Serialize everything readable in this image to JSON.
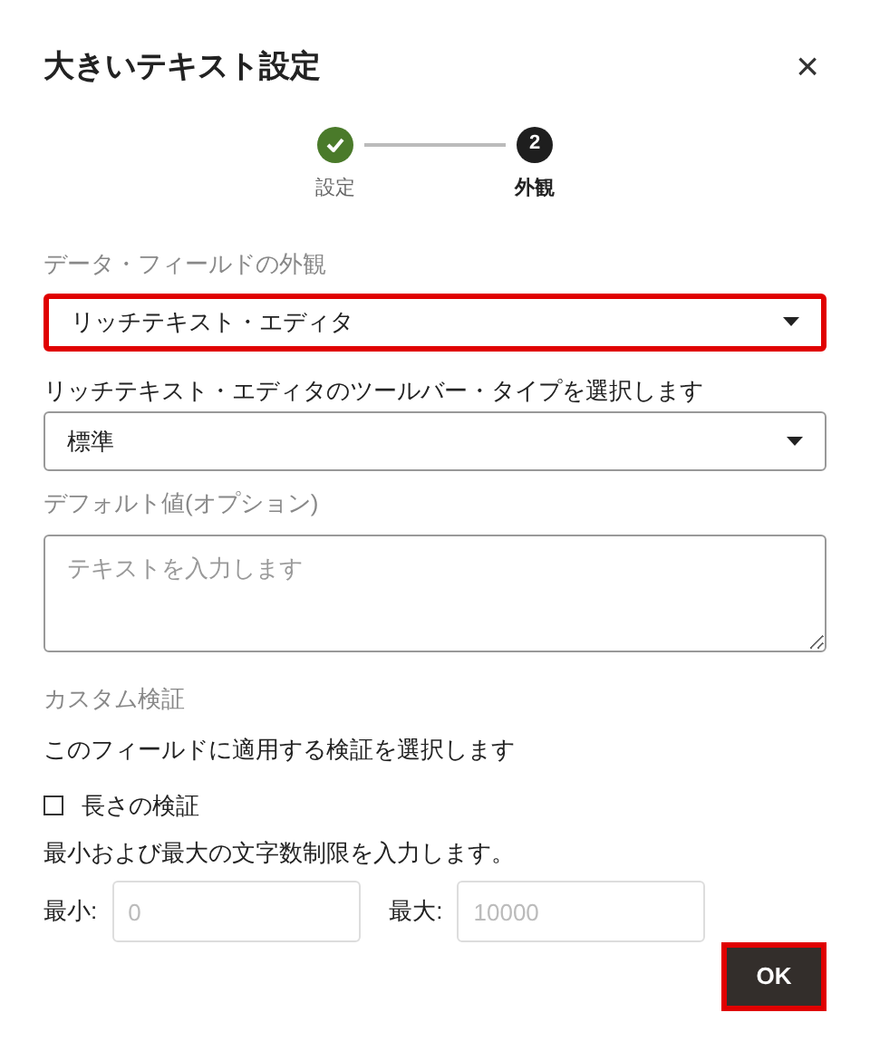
{
  "dialog": {
    "title": "大きいテキスト設定",
    "close": "×"
  },
  "steps": [
    {
      "label": "設定",
      "completed": true,
      "selected": false
    },
    {
      "label": "外観",
      "number": "2",
      "completed": false,
      "selected": true
    }
  ],
  "appearance": {
    "label": "データ・フィールドの外観",
    "value": "リッチテキスト・エディタ",
    "highlighted": true
  },
  "toolbar_type": {
    "label": "リッチテキスト・エディタのツールバー・タイプを選択します",
    "value": "標準",
    "highlighted": false
  },
  "default_value": {
    "label": "デフォルト値(オプション)",
    "placeholder": "テキストを入力します"
  },
  "custom_validation": {
    "heading": "カスタム検証",
    "description": "このフィールドに適用する検証を選択します"
  },
  "length_check": {
    "label": "長さの検証",
    "checked": false
  },
  "limit_hint": "最小および最大の文字数制限を入力します。",
  "limits": [
    {
      "label": "最小:",
      "placeholder": "0"
    },
    {
      "label": "最大:",
      "placeholder": "10000"
    }
  ],
  "ok_button": {
    "label": "OK",
    "highlighted": true
  }
}
